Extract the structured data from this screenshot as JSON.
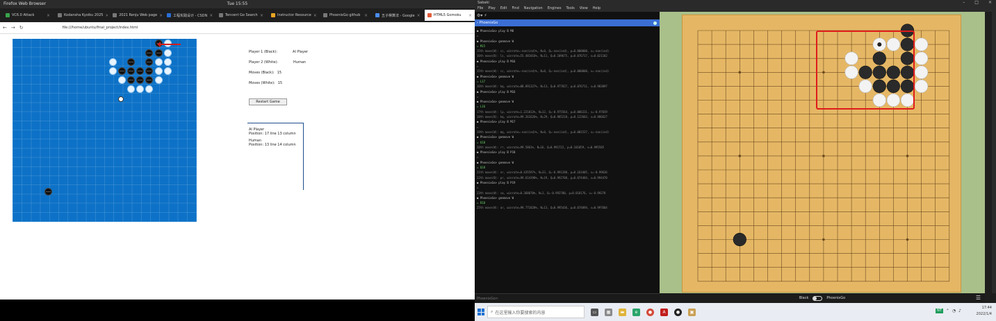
{
  "os_bar": {
    "app": "Firefox Web Browser",
    "clock": "Tue 15:55"
  },
  "browser": {
    "tabs": [
      {
        "label": "VC6.0 Attack",
        "color": "#3aa34a"
      },
      {
        "label": "Kodansha Kyoiku 2025",
        "color": "#777"
      },
      {
        "label": "2021 Renju Web page",
        "color": "#777"
      },
      {
        "label": "工程实践设计 - CSDN",
        "color": "#2a6fd6"
      },
      {
        "label": "Tencent Go Search",
        "color": "#777"
      },
      {
        "label": "Instructor Resource",
        "color": "#e8a424"
      },
      {
        "label": "PhoenixGo github",
        "color": "#777"
      },
      {
        "label": "五子棋算法 - Google",
        "color": "#4a8cf0"
      },
      {
        "label": "HTML5 Gomoku",
        "color": "#e15b3a",
        "active": true
      }
    ],
    "nav": {
      "back": "←",
      "forward": "→",
      "reload": "↻"
    },
    "url": "file:///home/ubuntu/final_project/index.html",
    "game": {
      "player1_label": "Player 1 (Black):",
      "player1_value": "AI Player",
      "player2_label": "Player 2 (White):",
      "player2_value": "Human",
      "count_black_label": "Moves (Black):",
      "count_black_value": "15",
      "count_white_label": "Moves (White):",
      "count_white_value": "15",
      "restart_label": "Restart Game",
      "log": [
        {
          "who": "AI Player",
          "text": "Position: 17 line 13 column"
        },
        {
          "who": "Human",
          "text": "Position: 13 line 14 column"
        }
      ]
    }
  },
  "sabaki": {
    "title": "Sabaki",
    "menu": [
      "File",
      "Play",
      "Edit",
      "Find",
      "Navigation",
      "Engines",
      "Tools",
      "View",
      "Help"
    ],
    "window_controls": [
      "–",
      "□",
      "×"
    ],
    "engine_name": "PhoenixGo",
    "console_lines": [
      {
        "t": "cmd",
        "s": "● PhoenixGo> play B M8"
      },
      {
        "t": "out",
        "s": "="
      },
      {
        "t": "cmd",
        "s": "● PhoenixGo> genmove W"
      },
      {
        "t": "res",
        "s": "= M15"
      },
      {
        "t": "out",
        "s": "15th move(W): cc, winrate=-nan(ind)%, N=0, Q=-nan(ind), p=0.000000, v=-nan(ind)"
      },
      {
        "t": "out",
        "s": "16th move(B): ls, winrate=55.481816%, N=11, Q=0.109675, p=0.076717, v=0.021182"
      },
      {
        "t": "cmd",
        "s": "● PhoenixGo> play B M16"
      },
      {
        "t": "out",
        "s": "="
      },
      {
        "t": "out",
        "s": "15th move(W): cc, winrate=-nan(ind)%, N=0, Q=-nan(ind), p=0.000000, v=-nan(ind)"
      },
      {
        "t": "cmd",
        "s": "● PhoenixGo> genmove W"
      },
      {
        "t": "res",
        "s": "= L17"
      },
      {
        "t": "out",
        "s": "16th move(W): kq, winrate=88.891327%, N=13, Q=0.977827, p=0.076711, v=0.983897"
      },
      {
        "t": "cmd",
        "s": "● PhoenixGo> play B M16"
      },
      {
        "t": "out",
        "s": "="
      },
      {
        "t": "cmd",
        "s": "● PhoenixGo> genmove W"
      },
      {
        "t": "res",
        "s": "= L16"
      },
      {
        "t": "out",
        "s": "17th move(W): lp, winrate=1.221813%, N=12, Q=-0.975564, p=0.086331, v=-0.97659"
      },
      {
        "t": "out",
        "s": "18th move(B): kq, winrate=99.261626%, N=29, Q=0.985218, p=0.122603, v=0.986627"
      },
      {
        "t": "cmd",
        "s": "● PhoenixGo> play B M17"
      },
      {
        "t": "out",
        "s": "="
      },
      {
        "t": "out",
        "s": "19th move(W): mq, winrate=-nan(ind)%, N=0, Q=-nan(ind), p=0.001527, v=-nan(ind)"
      },
      {
        "t": "cmd",
        "s": "● PhoenixGo> genmove W"
      },
      {
        "t": "res",
        "s": "= O18"
      },
      {
        "t": "out",
        "s": "20th move(W): rr, winrate=99.5861%, N=16, Q=0.991722, p=0.181059, v=0.995585"
      },
      {
        "t": "cmd",
        "s": "● PhoenixGo> play B P18"
      },
      {
        "t": "out",
        "s": "="
      },
      {
        "t": "cmd",
        "s": "● PhoenixGo> genmove W"
      },
      {
        "t": "res",
        "s": "= Q18"
      },
      {
        "t": "out",
        "s": "21th move(W): nr, winrate=0.435597%, N=33, Q=-0.991288, p=0.163405, v=-0.99636"
      },
      {
        "t": "out",
        "s": "22th move(B): pr, winrate=99.614398%, N=19, Q=0.992708, p=0.074484, v=0.994470"
      },
      {
        "t": "cmd",
        "s": "● PhoenixGo> play B P19"
      },
      {
        "t": "out",
        "s": "="
      },
      {
        "t": "out",
        "s": "23th move(W): sa, winrate=0.368070%, N=1, Q=-0.992780, p=0.018176, v=-0.99278"
      },
      {
        "t": "cmd",
        "s": "● PhoenixGo> genmove W"
      },
      {
        "t": "res",
        "s": "= R18"
      },
      {
        "t": "out",
        "s": "25th move(W): ar, winrate=99.771828%, N=13, Q=0.995436, p=0.074894, v=0.997684"
      }
    ],
    "console_footer": "PhoenixGo>",
    "status": {
      "black": "Black",
      "white": "PhoenixGo"
    }
  },
  "taskbar": {
    "search_placeholder": "在这里输入你要搜索的内容",
    "time": "17:44",
    "date": "2022/1/4",
    "nt": "NT",
    "icons": [
      "task-view",
      "file-explorer",
      "edge",
      "chrome",
      "acrobat",
      "sabaki",
      "wechat"
    ]
  }
}
